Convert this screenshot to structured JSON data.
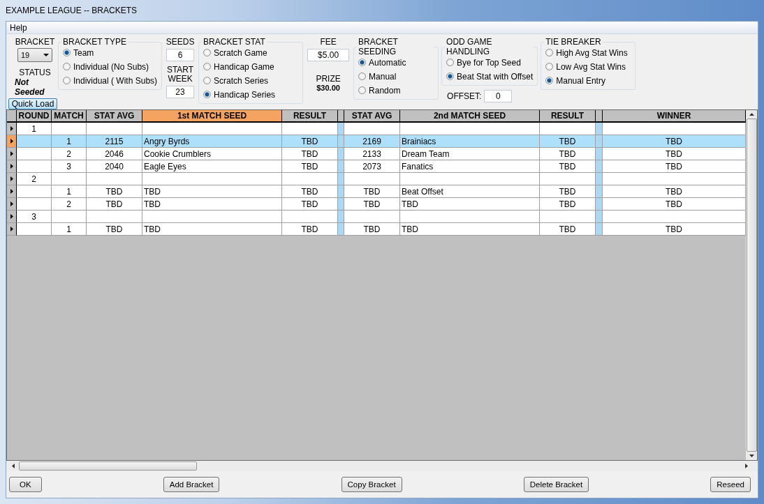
{
  "window": {
    "title": "EXAMPLE LEAGUE -- BRACKETS"
  },
  "menu": [
    "Help"
  ],
  "bracket": {
    "label": "BRACKET",
    "value": "19"
  },
  "status": {
    "label": "STATUS",
    "value": "Not Seeded"
  },
  "quick_load": "Quick Load",
  "bracket_type": {
    "title": "BRACKET TYPE",
    "options": [
      {
        "label": "Team",
        "selected": true
      },
      {
        "label": "Individual (No Subs)",
        "selected": false
      },
      {
        "label": "Individual ( With Subs)",
        "selected": false
      }
    ]
  },
  "seeds": {
    "label": "SEEDS",
    "value": "6"
  },
  "start_week": {
    "label": "START WEEK",
    "value": "23"
  },
  "bracket_stat": {
    "title": "BRACKET STAT",
    "options": [
      {
        "label": "Scratch Game",
        "selected": false
      },
      {
        "label": "Handicap Game",
        "selected": false
      },
      {
        "label": "Scratch Series",
        "selected": false
      },
      {
        "label": "Handicap Series",
        "selected": true
      }
    ]
  },
  "fee": {
    "label": "FEE",
    "value": "$5.00"
  },
  "prize": {
    "label": "PRIZE",
    "value": "$30.00"
  },
  "bracket_seeding": {
    "title": "BRACKET SEEDING",
    "options": [
      {
        "label": "Automatic",
        "selected": true
      },
      {
        "label": "Manual",
        "selected": false
      },
      {
        "label": "Random",
        "selected": false
      }
    ]
  },
  "odd_game_handling": {
    "title": "ODD GAME HANDLING",
    "options": [
      {
        "label": "Bye for Top Seed",
        "selected": false
      },
      {
        "label": "Beat Stat with Offset",
        "selected": true
      }
    ]
  },
  "offset": {
    "label": "OFFSET:",
    "value": "0"
  },
  "tie_breaker": {
    "title": "TIE BREAKER",
    "options": [
      {
        "label": "High Avg Stat Wins",
        "selected": false
      },
      {
        "label": "Low Avg Stat Wins",
        "selected": false
      },
      {
        "label": "Manual Entry",
        "selected": true
      }
    ]
  },
  "table": {
    "columns": [
      {
        "label": "ROUND",
        "selected": false
      },
      {
        "label": "MATCH",
        "selected": false
      },
      {
        "label": "STAT AVG",
        "selected": false
      },
      {
        "label": "1st MATCH SEED",
        "selected": true
      },
      {
        "label": "RESULT",
        "selected": false
      },
      {
        "label": "STAT AVG",
        "selected": false
      },
      {
        "label": "2nd MATCH SEED",
        "selected": false
      },
      {
        "label": "RESULT",
        "selected": false
      },
      {
        "label": "WINNER",
        "selected": false
      }
    ],
    "rows": [
      {
        "kind": "round",
        "round": "1",
        "selected": false
      },
      {
        "kind": "match",
        "selected": true,
        "cells": [
          "1",
          "2115",
          "Angry Byrds",
          "TBD",
          "2169",
          "Brainiacs",
          "TBD",
          "TBD"
        ]
      },
      {
        "kind": "match",
        "selected": false,
        "cells": [
          "2",
          "2046",
          "Cookie Crumblers",
          "TBD",
          "2133",
          "Dream Team",
          "TBD",
          "TBD"
        ]
      },
      {
        "kind": "match",
        "selected": false,
        "cells": [
          "3",
          "2040",
          "Eagle Eyes",
          "TBD",
          "2073",
          "Fanatics",
          "TBD",
          "TBD"
        ]
      },
      {
        "kind": "round",
        "round": "2",
        "selected": false
      },
      {
        "kind": "match",
        "selected": false,
        "cells": [
          "1",
          "TBD",
          "TBD",
          "TBD",
          "TBD",
          "Beat Offset",
          "TBD",
          "TBD"
        ]
      },
      {
        "kind": "match",
        "selected": false,
        "cells": [
          "2",
          "TBD",
          "TBD",
          "TBD",
          "TBD",
          "TBD",
          "TBD",
          "TBD"
        ]
      },
      {
        "kind": "round",
        "round": "3",
        "selected": false
      },
      {
        "kind": "match",
        "selected": false,
        "cells": [
          "1",
          "TBD",
          "TBD",
          "TBD",
          "TBD",
          "TBD",
          "TBD",
          "TBD"
        ]
      }
    ]
  },
  "buttons": [
    "OK",
    "Add Bracket",
    "Copy Bracket",
    "Delete Bracket",
    "Reseed"
  ]
}
